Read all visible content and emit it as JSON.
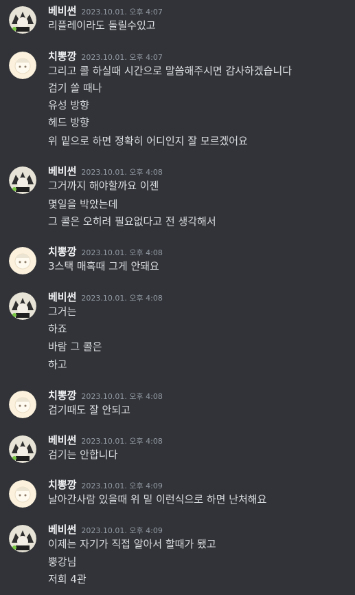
{
  "users": {
    "babi": {
      "name": "베비썬"
    },
    "chi": {
      "name": "치뽕깡"
    }
  },
  "messages": [
    {
      "user": "베비썬",
      "time": "2023.10.01. 오후 4:07",
      "lines": [
        "리플레이라도 돌릴수있고"
      ]
    },
    {
      "user": "치뽕깡",
      "time": "2023.10.01. 오후 4:07",
      "lines": [
        "그리고 콜 하실때 시간으로 말씀해주시면 감사하겠습니다",
        "검기 쏠 때나",
        "유성 방향",
        "헤드 방향",
        "위 밑으로 하면 정확히 어디인지 잘 모르겠어요"
      ]
    },
    {
      "user": "베비썬",
      "time": "2023.10.01. 오후 4:08",
      "lines": [
        "그거까지 해야할까요 이젠",
        "몇일을 박았는데",
        "그 콜은 오히려 필요없다고 전 생각해서"
      ]
    },
    {
      "user": "치뽕깡",
      "time": "2023.10.01. 오후 4:08",
      "lines": [
        "3스택 매혹때 그게 안돼요"
      ]
    },
    {
      "user": "베비썬",
      "time": "2023.10.01. 오후 4:08",
      "lines": [
        "그거는",
        "하죠",
        "바람 그 콜은",
        "하고"
      ]
    },
    {
      "user": "치뽕깡",
      "time": "2023.10.01. 오후 4:08",
      "lines": [
        "검기때도 잘 안되고"
      ]
    },
    {
      "user": "베비썬",
      "time": "2023.10.01. 오후 4:08",
      "lines": [
        "검기는 안합니다"
      ]
    },
    {
      "user": "치뽕깡",
      "time": "2023.10.01. 오후 4:09",
      "lines": [
        "날아간사람 있을때 위 밑 이런식으로 하면 난처해요"
      ]
    },
    {
      "user": "베비썬",
      "time": "2023.10.01. 오후 4:09",
      "lines": [
        "이제는 자기가 직접 알아서 할때가 됐고",
        "뿡강님",
        "저희 4관"
      ]
    }
  ]
}
